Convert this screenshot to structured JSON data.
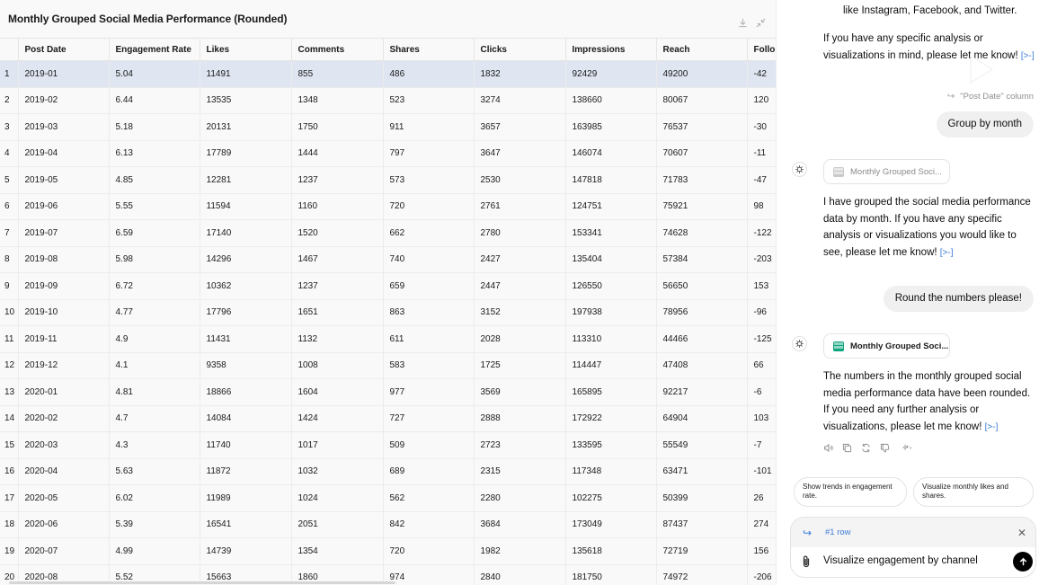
{
  "table_pane": {
    "title": "Monthly Grouped Social Media Performance (Rounded)",
    "columns": [
      "",
      "Post Date",
      "Engagement Rate",
      "Likes",
      "Comments",
      "Shares",
      "Clicks",
      "Impressions",
      "Reach",
      "Follo"
    ],
    "selected_row": 1,
    "rows": [
      [
        "1",
        "2019-01",
        "5.04",
        "11491",
        "855",
        "486",
        "1832",
        "92429",
        "49200",
        "-42"
      ],
      [
        "2",
        "2019-02",
        "6.44",
        "13535",
        "1348",
        "523",
        "3274",
        "138660",
        "80067",
        "120"
      ],
      [
        "3",
        "2019-03",
        "5.18",
        "20131",
        "1750",
        "911",
        "3657",
        "163985",
        "76537",
        "-30"
      ],
      [
        "4",
        "2019-04",
        "6.13",
        "17789",
        "1444",
        "797",
        "3647",
        "146074",
        "70607",
        "-11"
      ],
      [
        "5",
        "2019-05",
        "4.85",
        "12281",
        "1237",
        "573",
        "2530",
        "147818",
        "71783",
        "-47"
      ],
      [
        "6",
        "2019-06",
        "5.55",
        "11594",
        "1160",
        "720",
        "2761",
        "124751",
        "75921",
        "98"
      ],
      [
        "7",
        "2019-07",
        "6.59",
        "17140",
        "1520",
        "662",
        "2780",
        "153341",
        "74628",
        "-122"
      ],
      [
        "8",
        "2019-08",
        "5.98",
        "14296",
        "1467",
        "740",
        "2427",
        "135404",
        "57384",
        "-203"
      ],
      [
        "9",
        "2019-09",
        "6.72",
        "10362",
        "1237",
        "659",
        "2447",
        "126550",
        "56650",
        "153"
      ],
      [
        "10",
        "2019-10",
        "4.77",
        "17796",
        "1651",
        "863",
        "3152",
        "197938",
        "78956",
        "-96"
      ],
      [
        "11",
        "2019-11",
        "4.9",
        "11431",
        "1132",
        "611",
        "2028",
        "113310",
        "44466",
        "-125"
      ],
      [
        "12",
        "2019-12",
        "4.1",
        "9358",
        "1008",
        "583",
        "1725",
        "114447",
        "47408",
        "66"
      ],
      [
        "13",
        "2020-01",
        "4.81",
        "18866",
        "1604",
        "977",
        "3569",
        "165895",
        "92217",
        "-6"
      ],
      [
        "14",
        "2020-02",
        "4.7",
        "14084",
        "1424",
        "727",
        "2888",
        "172922",
        "64904",
        "103"
      ],
      [
        "15",
        "2020-03",
        "4.3",
        "11740",
        "1017",
        "509",
        "2723",
        "133595",
        "55549",
        "-7"
      ],
      [
        "16",
        "2020-04",
        "5.63",
        "11872",
        "1032",
        "689",
        "2315",
        "117348",
        "63471",
        "-101"
      ],
      [
        "17",
        "2020-05",
        "6.02",
        "11989",
        "1024",
        "562",
        "2280",
        "102275",
        "50399",
        "26"
      ],
      [
        "18",
        "2020-06",
        "5.39",
        "16541",
        "2051",
        "842",
        "3684",
        "173049",
        "87437",
        "274"
      ],
      [
        "19",
        "2020-07",
        "4.99",
        "14739",
        "1354",
        "720",
        "1982",
        "135618",
        "72719",
        "156"
      ],
      [
        "20",
        "2020-08",
        "5.52",
        "15663",
        "1860",
        "974",
        "2840",
        "181750",
        "74972",
        "-206"
      ]
    ]
  },
  "chat": {
    "msg1_partial_top": "like Instagram, Facebook, and Twitter.",
    "msg1_text": "If you have any specific analysis or visualizations in mind, please let me know!",
    "msg_link": "[>-]",
    "ref_line": "\"Post Date\" column",
    "user1": "Group by month",
    "chip1_label": "Monthly Grouped Soci...",
    "msg2_text": "I have grouped the social media performance data by month. If you have any specific analysis or visualizations you would like to see, please let me know!",
    "user2": "Round the numbers please!",
    "chip2_label": "Monthly Grouped Soci...",
    "msg3_text": "The numbers in the monthly grouped social media performance data have been rounded. If you need any further analysis or visualizations, please let me know!",
    "suggestions": [
      "Show trends in engagement rate.",
      "Visualize monthly likes and shares."
    ],
    "composer": {
      "row_ref": "#1 row",
      "input_value": "Visualize engagement by channel"
    }
  },
  "icons": {
    "download": "download-icon",
    "collapse": "collapse-icon",
    "assistant": "assistant-logo-icon",
    "play": "play-icon",
    "reply": "reply-arrow-icon",
    "speaker": "read-aloud-icon",
    "copy": "copy-icon",
    "regenerate": "regenerate-icon",
    "thumbs_down": "thumbs-down-icon",
    "sparkle": "sparkle-icon",
    "close": "close-icon",
    "attach": "paperclip-icon",
    "send": "send-arrow-icon"
  },
  "colors": {
    "selected_row": "#dfe5f1",
    "link_blue": "#3b7bd6",
    "green_chip": "#10a37f"
  }
}
